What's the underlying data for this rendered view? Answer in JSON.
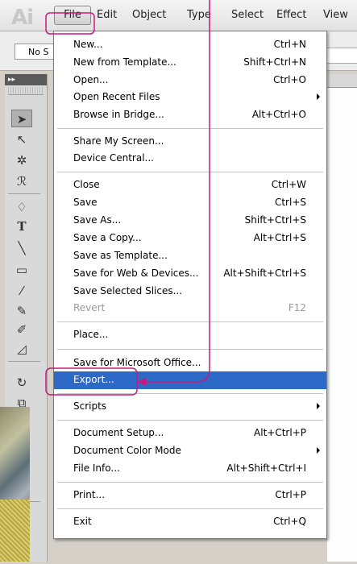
{
  "app": {
    "logo": "Ai"
  },
  "menubar": {
    "items": [
      {
        "label": "File"
      },
      {
        "label": "Edit"
      },
      {
        "label": "Object"
      },
      {
        "label": "Type"
      },
      {
        "label": "Select"
      },
      {
        "label": "Effect"
      },
      {
        "label": "View"
      }
    ]
  },
  "controlbar": {
    "field_text": "No S"
  },
  "toolpanel": {
    "header": "▸▸"
  },
  "file_menu": {
    "items": [
      {
        "label": "New...",
        "shortcut": "Ctrl+N"
      },
      {
        "label": "New from Template...",
        "shortcut": "Shift+Ctrl+N"
      },
      {
        "label": "Open...",
        "shortcut": "Ctrl+O"
      },
      {
        "label": "Open Recent Files",
        "shortcut": ""
      },
      {
        "label": "Browse in Bridge...",
        "shortcut": "Alt+Ctrl+O"
      },
      {
        "label": "Share My Screen...",
        "shortcut": ""
      },
      {
        "label": "Device Central...",
        "shortcut": ""
      },
      {
        "label": "Close",
        "shortcut": "Ctrl+W"
      },
      {
        "label": "Save",
        "shortcut": "Ctrl+S"
      },
      {
        "label": "Save As...",
        "shortcut": "Shift+Ctrl+S"
      },
      {
        "label": "Save a Copy...",
        "shortcut": "Alt+Ctrl+S"
      },
      {
        "label": "Save as Template...",
        "shortcut": ""
      },
      {
        "label": "Save for Web & Devices...",
        "shortcut": "Alt+Shift+Ctrl+S"
      },
      {
        "label": "Save Selected Slices...",
        "shortcut": ""
      },
      {
        "label": "Revert",
        "shortcut": "F12"
      },
      {
        "label": "Place...",
        "shortcut": ""
      },
      {
        "label": "Save for Microsoft Office...",
        "shortcut": ""
      },
      {
        "label": "Export...",
        "shortcut": ""
      },
      {
        "label": "Scripts",
        "shortcut": ""
      },
      {
        "label": "Document Setup...",
        "shortcut": "Alt+Ctrl+P"
      },
      {
        "label": "Document Color Mode",
        "shortcut": ""
      },
      {
        "label": "File Info...",
        "shortcut": "Alt+Shift+Ctrl+I"
      },
      {
        "label": "Print...",
        "shortcut": "Ctrl+P"
      },
      {
        "label": "Exit",
        "shortcut": "Ctrl+Q"
      }
    ]
  },
  "colors": {
    "highlight": "#2d6ac8",
    "annotation": "#c8197a"
  }
}
